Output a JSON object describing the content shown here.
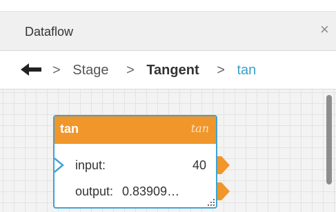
{
  "window": {
    "title": "Dataflow",
    "close_glyph": "×"
  },
  "breadcrumb": {
    "back_icon": "arrow-left-icon",
    "separator": ">",
    "items": [
      "Stage",
      "Tangent",
      "tan"
    ]
  },
  "node": {
    "title": "tan",
    "formula": "tan",
    "ports": {
      "input": {
        "label": "input:",
        "value": "40"
      },
      "output": {
        "label": "output:",
        "value": "0.83909…"
      }
    }
  },
  "colors": {
    "header_orange": "#f0962a",
    "node_border": "#3ea3d4",
    "active_crumb": "#3ba0c8"
  }
}
